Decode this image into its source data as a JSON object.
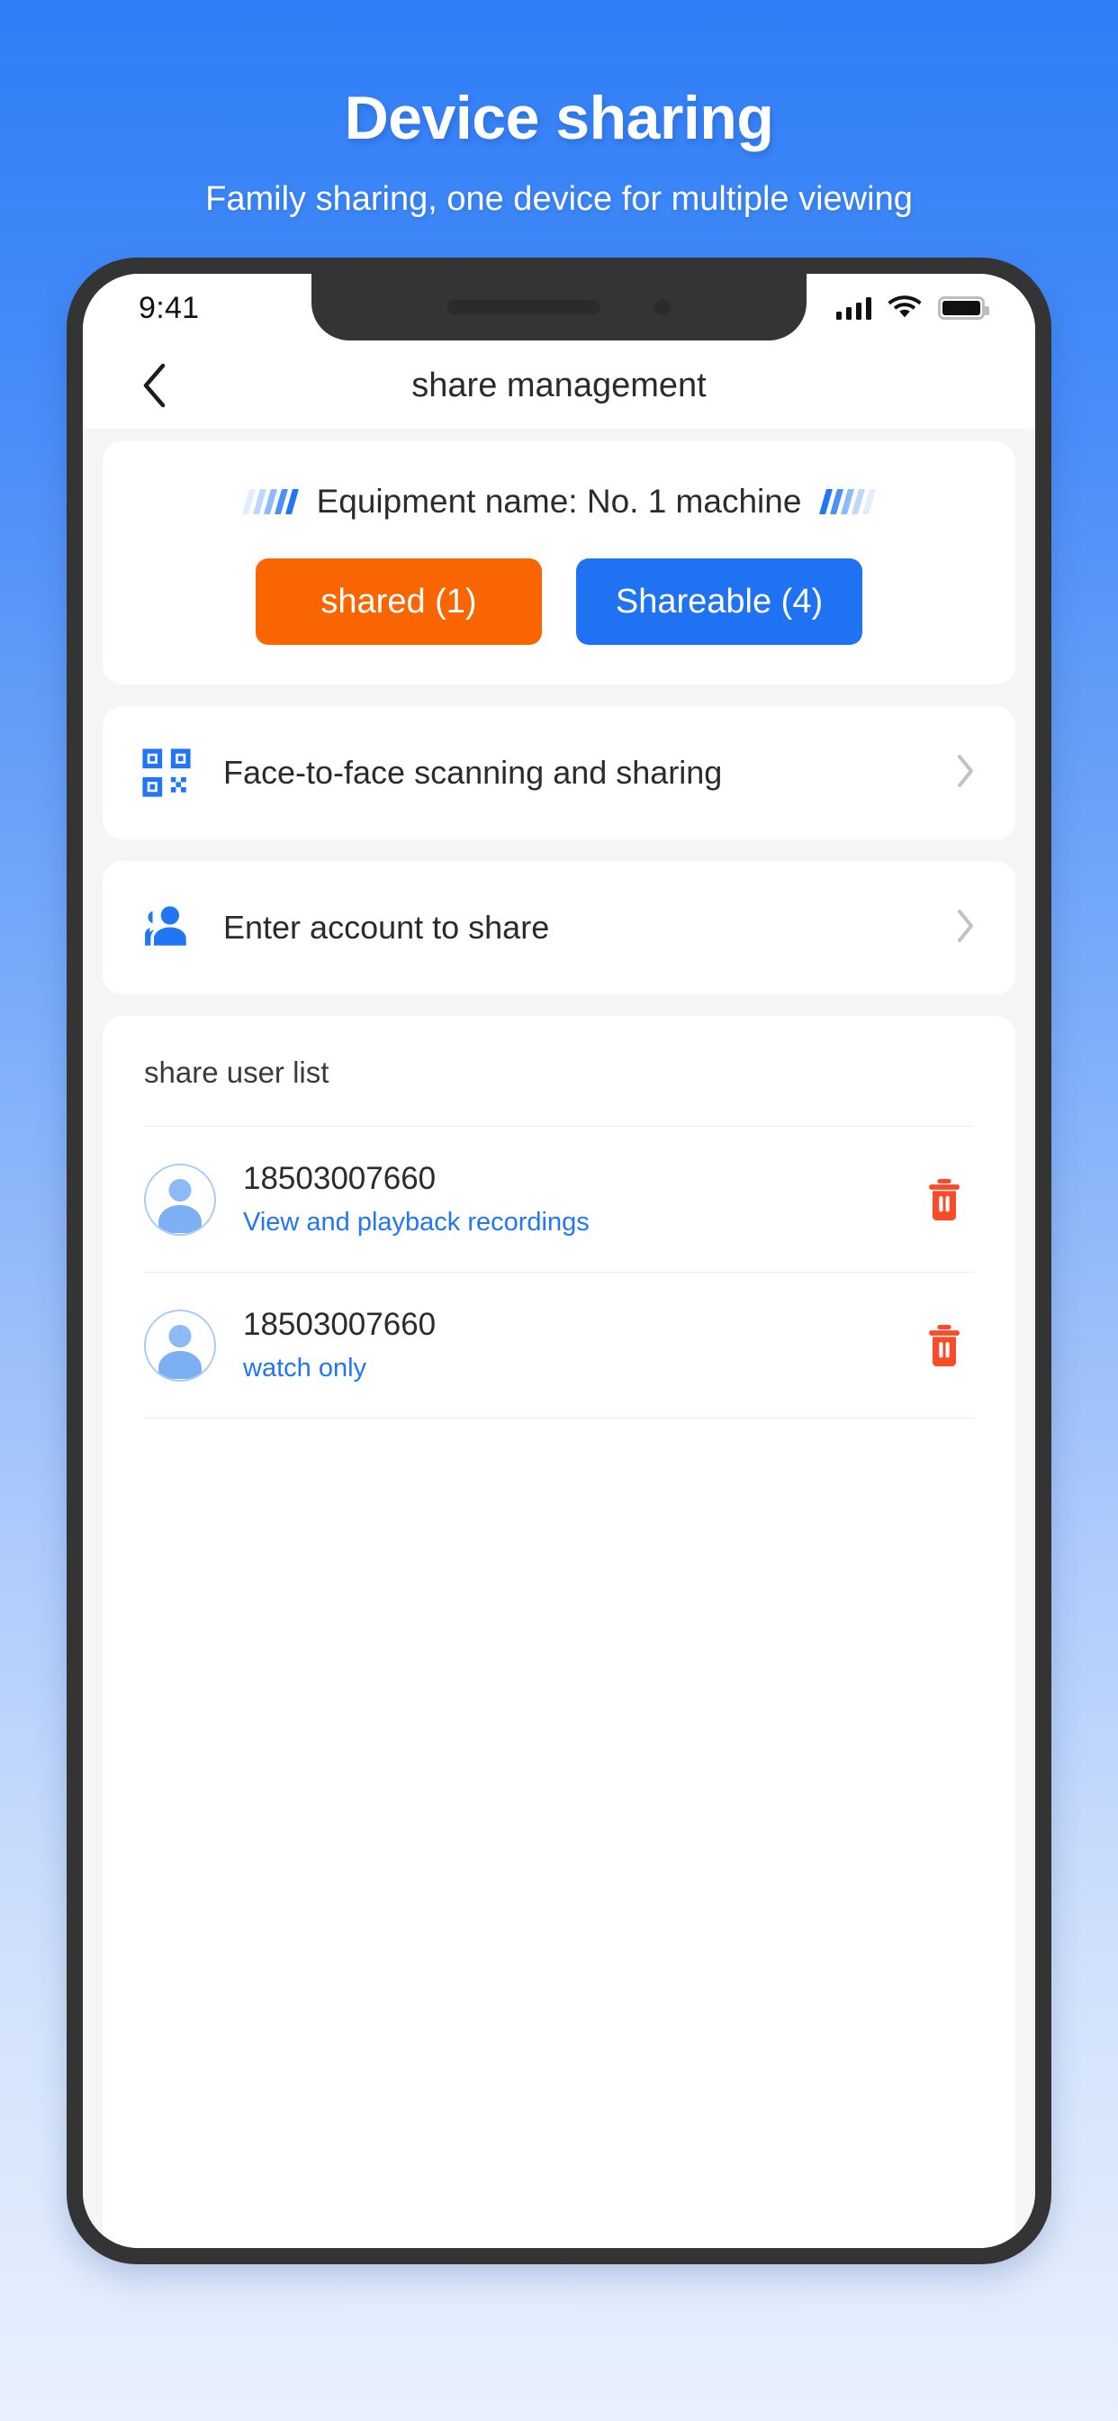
{
  "promo": {
    "title": "Device sharing",
    "subtitle": "Family sharing, one device for multiple viewing"
  },
  "colors": {
    "accent_blue": "#2176f5",
    "accent_orange": "#f96500",
    "danger_red": "#f94b28",
    "page_bg": "#f5f5f5",
    "promo_gradient_top": "#2f7ef7",
    "promo_gradient_bottom": "#e8f0fd"
  },
  "status_bar": {
    "time": "9:41",
    "signal_icon": "cellular-signal-icon",
    "wifi_icon": "wifi-icon",
    "battery_icon": "battery-full-icon"
  },
  "navbar": {
    "back_icon": "chevron-left-icon",
    "title": "share management"
  },
  "device_card": {
    "decor_icon": "stripes-decoration-icon",
    "device_name": "Equipment name: No. 1 machine",
    "tabs": [
      {
        "label": "shared (1)",
        "state": "active",
        "color": "#f96500"
      },
      {
        "label": "Shareable (4)",
        "state": "inactive",
        "color": "#1f72f2"
      }
    ]
  },
  "actions": [
    {
      "icon": "qr-code-icon",
      "label": "Face-to-face scanning and sharing",
      "chevron": "chevron-right-icon"
    },
    {
      "icon": "add-user-icon",
      "label": "Enter account to share",
      "chevron": "chevron-right-icon"
    }
  ],
  "share_list": {
    "title": "share user list",
    "users": [
      {
        "avatar_icon": "user-avatar-icon",
        "phone": "18503007660",
        "permission": "View and playback recordings",
        "delete_icon": "trash-icon"
      },
      {
        "avatar_icon": "user-avatar-icon",
        "phone": "18503007660",
        "permission": "watch only",
        "delete_icon": "trash-icon"
      }
    ]
  }
}
